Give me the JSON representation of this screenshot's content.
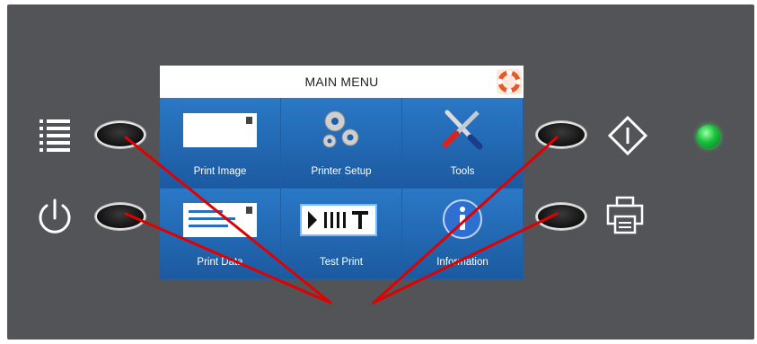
{
  "screen": {
    "title": "MAIN MENU",
    "help_icon": "help-lifebuoy-icon",
    "tiles": [
      {
        "label": "Print Image",
        "icon": "print-image-icon"
      },
      {
        "label": "Printer Setup",
        "icon": "gears-icon"
      },
      {
        "label": "Tools",
        "icon": "tools-icon"
      },
      {
        "label": "Print Data",
        "icon": "print-data-icon"
      },
      {
        "label": "Test Print",
        "icon": "test-print-icon"
      },
      {
        "label": "Information",
        "icon": "information-icon"
      }
    ]
  },
  "side_controls": {
    "left_top_icon": "menu-list-icon",
    "left_bottom_icon": "power-icon",
    "right_top_icon": "diamond-start-icon",
    "right_bottom_icon": "printer-icon",
    "status_led_color": "#18c23a"
  },
  "colors": {
    "bezel": "#535457",
    "screen_blue": "#1f5fa6",
    "annotation_red": "#e00000"
  }
}
